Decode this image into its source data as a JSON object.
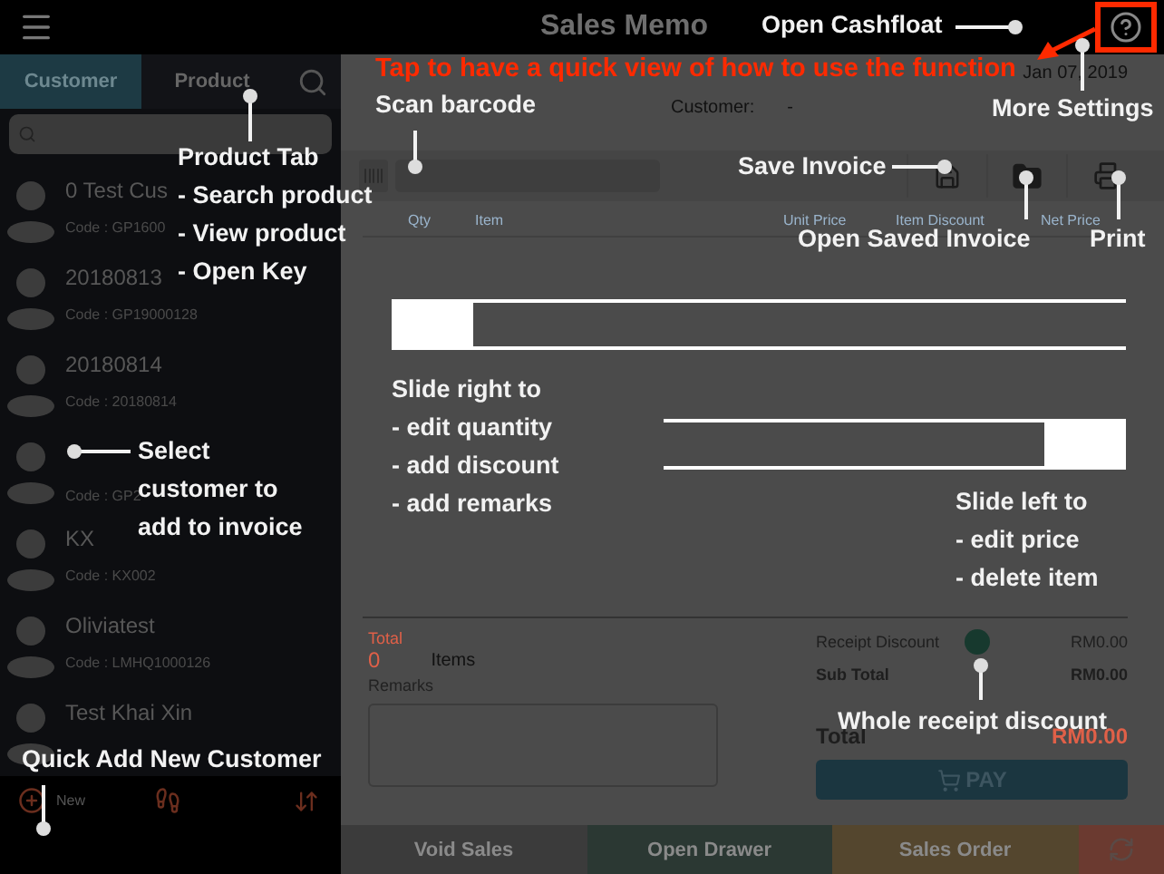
{
  "top_bar": {
    "title": "Sales Memo"
  },
  "sidebar": {
    "tabs": [
      {
        "label": "Customer",
        "selected": true
      },
      {
        "label": "Product",
        "selected": false
      }
    ],
    "customers": [
      {
        "name": "0 Test Cus",
        "code": "Code : GP1600"
      },
      {
        "name": "20180813",
        "code": "Code : GP19000128"
      },
      {
        "name": "20180814",
        "code": "Code : 20180814"
      },
      {
        "code": "Code : GP2"
      },
      {
        "name": "KX",
        "code": "Code : KX002"
      },
      {
        "name": "Oliviatest",
        "code": "Code : LMHQ1000126"
      },
      {
        "name": "Test Khai Xin"
      }
    ],
    "new_label": "New"
  },
  "invoice": {
    "date": "Jan 07, 2019",
    "customer_label": "Customer:",
    "customer_value": "-",
    "columns": [
      "Qty",
      "Item",
      "Unit Price",
      "Item Discount",
      "Net Price"
    ],
    "total_label": "Total",
    "item_count": "0",
    "items_label": "Items",
    "remarks_label": "Remarks",
    "summary": [
      {
        "kind": "discount",
        "label": "Receipt Discount",
        "value": "RM0.00"
      },
      {
        "kind": "subtotal",
        "label": "Sub Total",
        "value": "RM0.00"
      },
      {
        "kind": "total",
        "label": "Total",
        "value": "RM0.00"
      }
    ],
    "pay": "PAY"
  },
  "actions": [
    {
      "kind": "text",
      "label": "Void Sales",
      "color": "#3b3b3b"
    },
    {
      "kind": "text",
      "label": "Open Drawer",
      "color": "#2b3833"
    },
    {
      "kind": "text",
      "label": "Sales Order",
      "color": "#54462e"
    },
    {
      "kind": "refresh",
      "color": "#6b3a30"
    }
  ],
  "guide": {
    "title": "Tap to have a quick view of how to use the function",
    "callouts": [
      {
        "lines": [
          "Open Cashfloat"
        ]
      },
      {
        "lines": [
          "More Settings"
        ]
      },
      {
        "lines": [
          "Product Tab",
          "- Search product",
          "- View product",
          "- Open Key"
        ]
      },
      {
        "lines": [
          "Scan barcode"
        ]
      },
      {
        "lines": [
          "Save Invoice"
        ]
      },
      {
        "lines": [
          "Open Saved Invoice"
        ]
      },
      {
        "lines": [
          "Print"
        ]
      },
      {
        "lines": [
          "Select",
          "customer to",
          "add to invoice"
        ]
      },
      {
        "lines": [
          "Quick Add New Customer"
        ]
      },
      {
        "lines": [
          "Whole receipt discount"
        ]
      }
    ],
    "swipe_demos": [
      {
        "kind": "right",
        "lines": [
          "Slide right to",
          "- edit quantity",
          "- add discount",
          "- add remarks"
        ]
      },
      {
        "kind": "left",
        "lines": [
          "Slide left to",
          "- edit price",
          "- delete item"
        ]
      }
    ]
  }
}
